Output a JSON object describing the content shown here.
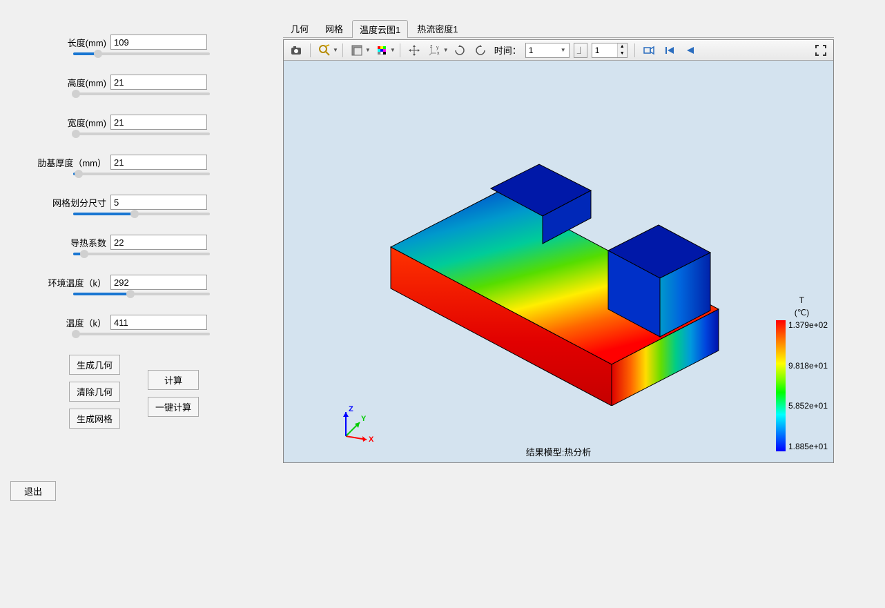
{
  "sidebar": {
    "params": [
      {
        "label": "长度(mm)",
        "value": "109",
        "fill": 18
      },
      {
        "label": "高度(mm)",
        "value": "21",
        "fill": 2
      },
      {
        "label": "宽度(mm)",
        "value": "21",
        "fill": 2
      },
      {
        "label": "肋基厚度（mm）",
        "value": "21",
        "fill": 4
      },
      {
        "label": "网格划分尺寸",
        "value": "5",
        "fill": 45
      },
      {
        "label": "导热系数",
        "value": "22",
        "fill": 8
      },
      {
        "label": "环境温度（k）",
        "value": "292",
        "fill": 42
      },
      {
        "label": "温度（k）",
        "value": "411",
        "fill": 2
      }
    ],
    "btn_generate_geom": "生成几何",
    "btn_clear_geom": "清除几何",
    "btn_generate_mesh": "生成网格",
    "btn_calculate": "计算",
    "btn_one_click": "一键计算",
    "btn_exit": "退出"
  },
  "tabs": {
    "items": [
      {
        "label": "几何",
        "active": false
      },
      {
        "label": "网格",
        "active": false
      },
      {
        "label": "温度云图1",
        "active": true
      },
      {
        "label": "热流密度1",
        "active": false
      }
    ]
  },
  "toolbar": {
    "time_label": "时间：",
    "time_value": "1",
    "frame_value": "1"
  },
  "viewer": {
    "footer": "结果模型:热分析",
    "legend": {
      "title": "T",
      "unit": "(℃)",
      "ticks": [
        "1.379e+02",
        "9.818e+01",
        "5.852e+01",
        "1.885e+01"
      ]
    }
  }
}
